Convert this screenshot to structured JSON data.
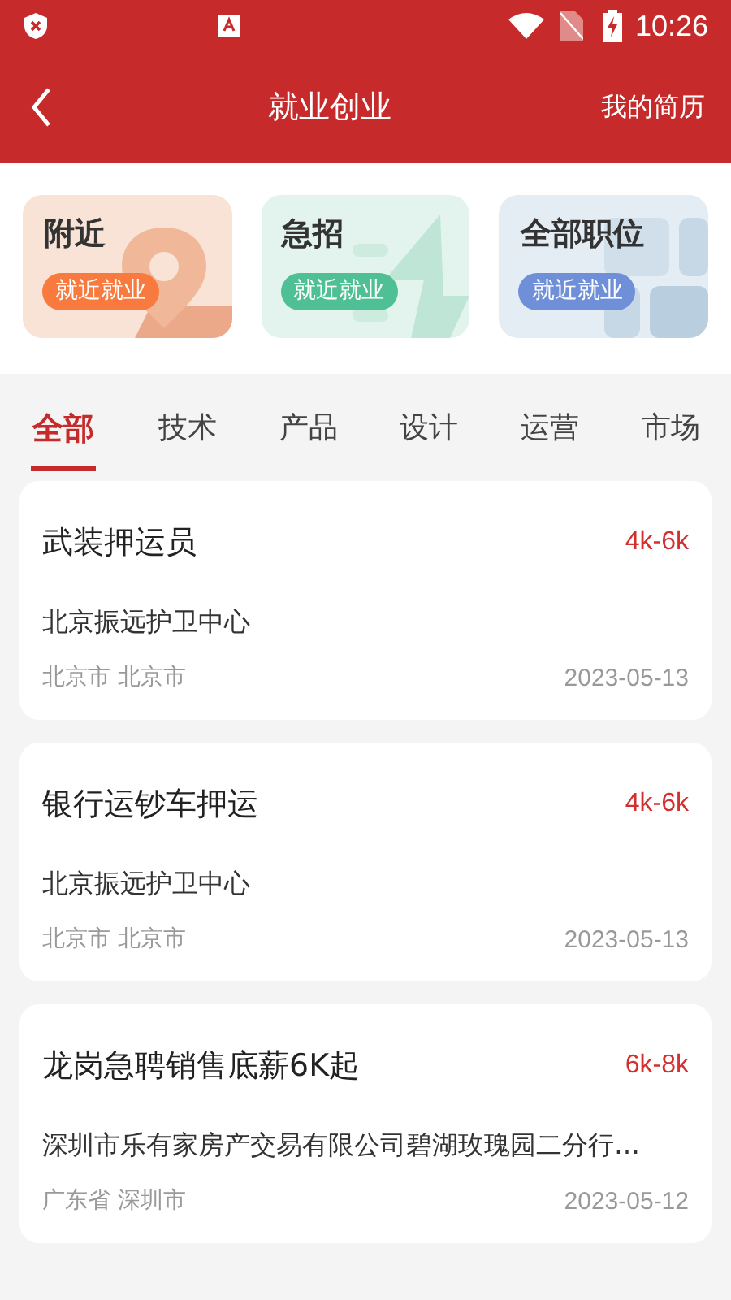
{
  "status_bar": {
    "time": "10:26"
  },
  "header": {
    "title": "就业创业",
    "action": "我的简历"
  },
  "shortcuts": [
    {
      "kind": "pin",
      "title": "附近",
      "tag": "就近就业",
      "color": "#f97a3e"
    },
    {
      "kind": "bolt",
      "title": "急招",
      "tag": "就近就业",
      "color": "#4fbf96"
    },
    {
      "kind": "grid",
      "title": "全部职位",
      "tag": "就近就业",
      "color": "#6f90d8"
    }
  ],
  "tabs": [
    {
      "label": "全部",
      "selected": true
    },
    {
      "label": "技术",
      "selected": false
    },
    {
      "label": "产品",
      "selected": false
    },
    {
      "label": "设计",
      "selected": false
    },
    {
      "label": "运营",
      "selected": false
    },
    {
      "label": "市场",
      "selected": false
    }
  ],
  "jobs": [
    {
      "title": "武装押运员",
      "salary": "4k-6k",
      "company": "北京振远护卫中心",
      "location": "北京市 北京市",
      "date": "2023-05-13"
    },
    {
      "title": "银行运钞车押运",
      "salary": "4k-6k",
      "company": "北京振远护卫中心",
      "location": "北京市 北京市",
      "date": "2023-05-13"
    },
    {
      "title": "龙岗急聘销售底薪6K起",
      "salary": "6k-8k",
      "company": "深圳市乐有家房产交易有限公司碧湖玫瑰园二分行…",
      "location": "广东省 深圳市",
      "date": "2023-05-12"
    }
  ]
}
